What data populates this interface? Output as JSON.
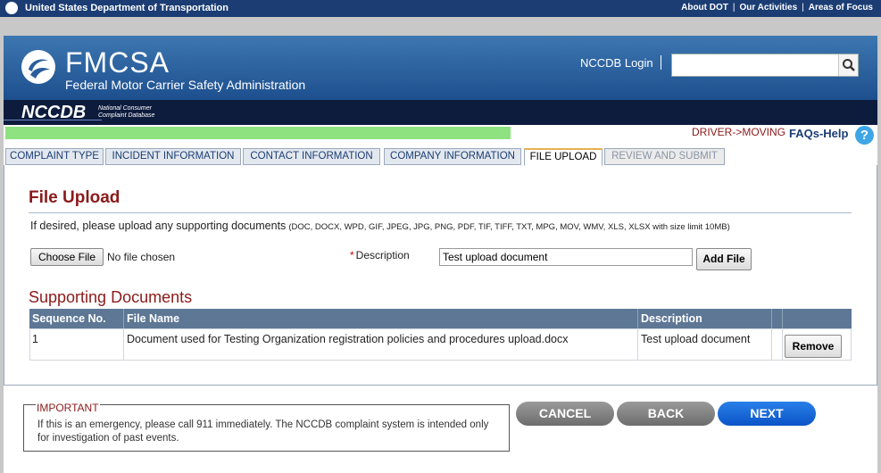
{
  "topbar": {
    "agency": "United States Department of Transportation",
    "links": [
      "About DOT",
      "Our Activities",
      "Areas of Focus"
    ],
    "separator": "|"
  },
  "header": {
    "title": "FMCSA",
    "subtitle": "Federal Motor Carrier Safety Administration",
    "login": "NCCDB Login",
    "search_placeholder": "",
    "logo_icon": "fmcsa-logo-icon",
    "search_icon": "search-icon"
  },
  "nccdb": {
    "title": "NCCDB",
    "subtitle_line1": "National Consumer",
    "subtitle_line2": "Complaint Database"
  },
  "progress": {
    "fraction": 0.58,
    "color": "#8ee27f"
  },
  "links": {
    "driver": "DRIVER->MOVING",
    "faq": "FAQs-Help",
    "faq_icon": "?"
  },
  "tabs": [
    {
      "label": "COMPLAINT TYPE",
      "state": "normal"
    },
    {
      "label": "INCIDENT INFORMATION",
      "state": "normal"
    },
    {
      "label": "CONTACT INFORMATION",
      "state": "normal"
    },
    {
      "label": "COMPANY INFORMATION",
      "state": "normal"
    },
    {
      "label": "FILE UPLOAD",
      "state": "active"
    },
    {
      "label": "REVIEW AND SUBMIT",
      "state": "disabled"
    }
  ],
  "upload": {
    "heading": "File Upload",
    "intro": "If desired, please upload any supporting documents",
    "types": "(DOC, DOCX, WPD, GIF, JPEG, JPG, PNG, PDF, TIF, TIFF, TXT, MPG, MOV, WMV, XLS, XLSX with size limit 10MB)",
    "choose_label": "Choose File",
    "no_file": "No file chosen",
    "required_mark": "*",
    "description_label": "Description",
    "description_value": "Test upload document",
    "add_label": "Add File"
  },
  "documents": {
    "heading": "Supporting Documents",
    "columns": [
      "Sequence No.",
      "File Name",
      "Description",
      ""
    ],
    "rows": [
      {
        "seq": "1",
        "file": "Document used for Testing Organization registration policies and procedures upload.docx",
        "description": "Test upload document",
        "action": "Remove"
      }
    ]
  },
  "important": {
    "title": "IMPORTANT",
    "text": "If this is an emergency, please call 911 immediately. The NCCDB complaint system is intended only for investigation of past events."
  },
  "actions": {
    "cancel": "CANCEL",
    "back": "BACK",
    "next": "NEXT"
  }
}
